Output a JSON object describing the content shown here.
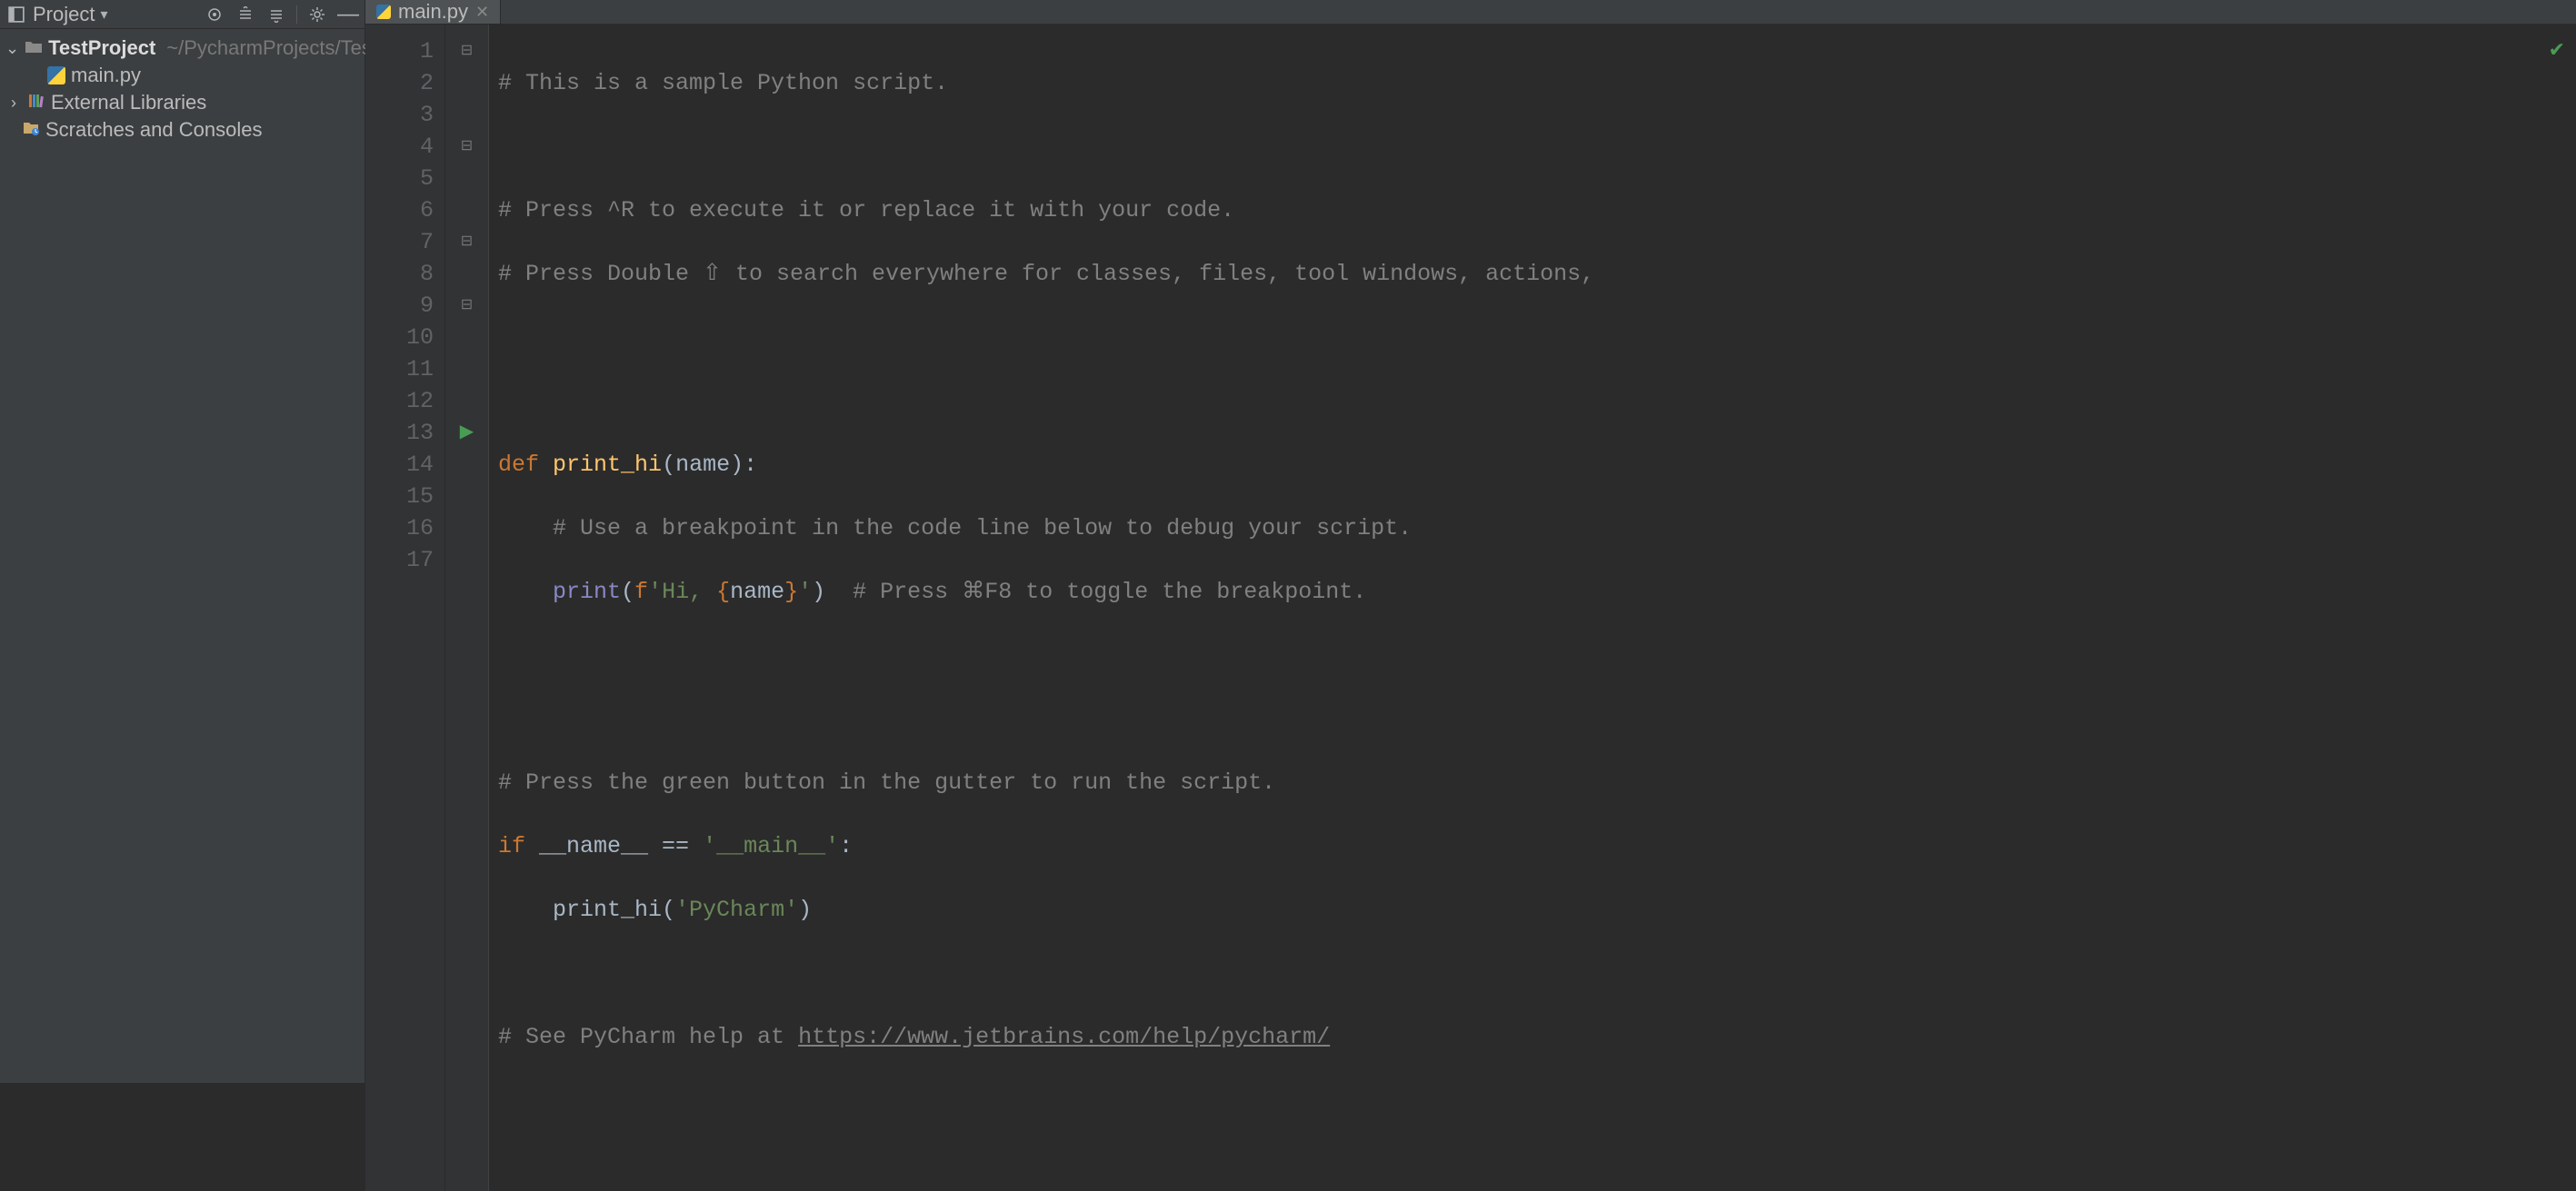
{
  "sidebar": {
    "title": "Project",
    "tree": {
      "root_name": "TestProject",
      "root_path": "~/PycharmProjects/TestProject",
      "file_main": "main.py",
      "external_libraries": "External Libraries",
      "scratches": "Scratches and Consoles"
    }
  },
  "tabs": {
    "active": "main.py"
  },
  "editor": {
    "line_count": 17,
    "lines": {
      "l1": "# This is a sample Python script.",
      "l3_comment": "# Press ^R to execute it or replace it with your code.",
      "l4_comment": "# Press Double ⇧ to search everywhere for classes, files, tool windows, actions,",
      "l7_def": "def",
      "l7_fn": "print_hi",
      "l7_sig_rest": "(name):",
      "l8_comment": "# Use a breakpoint in the code line below to debug your script.",
      "l9_print": "print",
      "l9_open": "(",
      "l9_f": "f",
      "l9_str_a": "'Hi, ",
      "l9_brace_o": "{",
      "l9_name": "name",
      "l9_brace_c": "}",
      "l9_str_b": "'",
      "l9_close": ")",
      "l9_comment": "# Press ⌘F8 to toggle the breakpoint.",
      "l12_comment": "# Press the green button in the gutter to run the script.",
      "l13_if": "if",
      "l13_mid": " __name__ == ",
      "l13_str": "'__main__'",
      "l13_colon": ":",
      "l14_call": "print_hi(",
      "l14_str": "'PyCharm'",
      "l14_close": ")",
      "l16_comment_a": "# See PyCharm help at ",
      "l16_url": "https://www.jetbrains.com/help/pycharm/"
    }
  }
}
